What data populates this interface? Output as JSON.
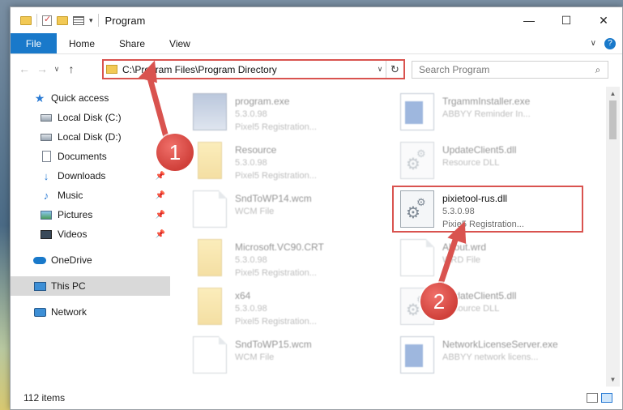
{
  "window": {
    "title": "Program",
    "controls": {
      "minimize": "—",
      "maximize": "☐",
      "close": "✕"
    }
  },
  "ribbon": {
    "tabs": [
      "File",
      "Home",
      "Share",
      "View"
    ]
  },
  "address": {
    "path": "C:\\Program Files\\Program Directory",
    "back": "←",
    "forward": "→",
    "recent": "∨",
    "up": "↑",
    "refresh": "↻",
    "dropdown": "∨"
  },
  "search": {
    "placeholder": "Search Program",
    "icon": "search-icon"
  },
  "sidebar": {
    "items": [
      {
        "label": "Quick access",
        "icon": "star-icon",
        "pinned": false
      },
      {
        "label": "Local Disk (C:)",
        "icon": "drive-icon",
        "pinned": false
      },
      {
        "label": "Local Disk (D:)",
        "icon": "drive-icon",
        "pinned": false
      },
      {
        "label": "Documents",
        "icon": "documents-icon",
        "pinned": false
      },
      {
        "label": "Downloads",
        "icon": "downloads-icon",
        "pinned": true
      },
      {
        "label": "Music",
        "icon": "music-icon",
        "pinned": true
      },
      {
        "label": "Pictures",
        "icon": "pictures-icon",
        "pinned": true
      },
      {
        "label": "Videos",
        "icon": "videos-icon",
        "pinned": true
      },
      {
        "label": "OneDrive",
        "icon": "cloud-icon",
        "pinned": false
      },
      {
        "label": "This PC",
        "icon": "computer-icon",
        "pinned": false,
        "selected": true
      },
      {
        "label": "Network",
        "icon": "network-icon",
        "pinned": false
      }
    ]
  },
  "files": {
    "left": [
      {
        "name": "program.exe",
        "line1": "5.3.0.98",
        "line2": "Pixel5 Registration...",
        "icon": "exe-icon"
      },
      {
        "name": "Resource",
        "line1": "5.3.0.98",
        "line2": "Pixel5 Registration...",
        "icon": "folder-icon"
      },
      {
        "name": "SndToWP14.wcm",
        "line1": "WCM File",
        "line2": "",
        "icon": "file-icon"
      },
      {
        "name": "Microsoft.VC90.CRT",
        "line1": "5.3.0.98",
        "line2": "Pixel5 Registration...",
        "icon": "folder-icon"
      },
      {
        "name": "x64",
        "line1": "5.3.0.98",
        "line2": "Pixel5 Registration...",
        "icon": "folder-icon"
      },
      {
        "name": "SndToWP15.wcm",
        "line1": "WCM File",
        "line2": "",
        "icon": "file-icon"
      }
    ],
    "right": [
      {
        "name": "TrgammInstaller.exe",
        "line1": "ABBYY Reminder In...",
        "line2": "",
        "icon": "app-icon"
      },
      {
        "name": "UpdateClient5.dll",
        "line1": "Resource DLL",
        "line2": "",
        "icon": "dll-icon"
      },
      {
        "name": "pixietool-rus.dll",
        "line1": "5.3.0.98",
        "line2": "Pixie5 Registration...",
        "icon": "dll-icon"
      },
      {
        "name": "About.wrd",
        "line1": "WRD File",
        "line2": "",
        "icon": "file-icon"
      },
      {
        "name": "UpdateClient5.dll",
        "line1": "Resource DLL",
        "line2": "",
        "icon": "dll-icon"
      },
      {
        "name": "NetworkLicenseServer.exe",
        "line1": "ABBYY network licens...",
        "line2": "",
        "icon": "app-icon"
      }
    ]
  },
  "status": {
    "count": "112 items"
  },
  "callouts": [
    "1",
    "2"
  ],
  "colors": {
    "accent": "#1979ca",
    "highlight": "#d9534f",
    "selected": "#d9d9d9"
  }
}
